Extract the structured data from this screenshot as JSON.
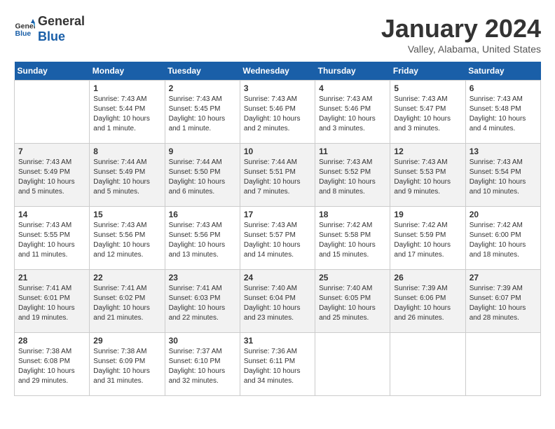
{
  "header": {
    "logo_line1": "General",
    "logo_line2": "Blue",
    "month": "January 2024",
    "location": "Valley, Alabama, United States"
  },
  "weekdays": [
    "Sunday",
    "Monday",
    "Tuesday",
    "Wednesday",
    "Thursday",
    "Friday",
    "Saturday"
  ],
  "weeks": [
    [
      {
        "day": "",
        "info": ""
      },
      {
        "day": "1",
        "info": "Sunrise: 7:43 AM\nSunset: 5:44 PM\nDaylight: 10 hours\nand 1 minute."
      },
      {
        "day": "2",
        "info": "Sunrise: 7:43 AM\nSunset: 5:45 PM\nDaylight: 10 hours\nand 1 minute."
      },
      {
        "day": "3",
        "info": "Sunrise: 7:43 AM\nSunset: 5:46 PM\nDaylight: 10 hours\nand 2 minutes."
      },
      {
        "day": "4",
        "info": "Sunrise: 7:43 AM\nSunset: 5:46 PM\nDaylight: 10 hours\nand 3 minutes."
      },
      {
        "day": "5",
        "info": "Sunrise: 7:43 AM\nSunset: 5:47 PM\nDaylight: 10 hours\nand 3 minutes."
      },
      {
        "day": "6",
        "info": "Sunrise: 7:43 AM\nSunset: 5:48 PM\nDaylight: 10 hours\nand 4 minutes."
      }
    ],
    [
      {
        "day": "7",
        "info": "Sunrise: 7:43 AM\nSunset: 5:49 PM\nDaylight: 10 hours\nand 5 minutes."
      },
      {
        "day": "8",
        "info": "Sunrise: 7:44 AM\nSunset: 5:49 PM\nDaylight: 10 hours\nand 5 minutes."
      },
      {
        "day": "9",
        "info": "Sunrise: 7:44 AM\nSunset: 5:50 PM\nDaylight: 10 hours\nand 6 minutes."
      },
      {
        "day": "10",
        "info": "Sunrise: 7:44 AM\nSunset: 5:51 PM\nDaylight: 10 hours\nand 7 minutes."
      },
      {
        "day": "11",
        "info": "Sunrise: 7:43 AM\nSunset: 5:52 PM\nDaylight: 10 hours\nand 8 minutes."
      },
      {
        "day": "12",
        "info": "Sunrise: 7:43 AM\nSunset: 5:53 PM\nDaylight: 10 hours\nand 9 minutes."
      },
      {
        "day": "13",
        "info": "Sunrise: 7:43 AM\nSunset: 5:54 PM\nDaylight: 10 hours\nand 10 minutes."
      }
    ],
    [
      {
        "day": "14",
        "info": "Sunrise: 7:43 AM\nSunset: 5:55 PM\nDaylight: 10 hours\nand 11 minutes."
      },
      {
        "day": "15",
        "info": "Sunrise: 7:43 AM\nSunset: 5:56 PM\nDaylight: 10 hours\nand 12 minutes."
      },
      {
        "day": "16",
        "info": "Sunrise: 7:43 AM\nSunset: 5:56 PM\nDaylight: 10 hours\nand 13 minutes."
      },
      {
        "day": "17",
        "info": "Sunrise: 7:43 AM\nSunset: 5:57 PM\nDaylight: 10 hours\nand 14 minutes."
      },
      {
        "day": "18",
        "info": "Sunrise: 7:42 AM\nSunset: 5:58 PM\nDaylight: 10 hours\nand 15 minutes."
      },
      {
        "day": "19",
        "info": "Sunrise: 7:42 AM\nSunset: 5:59 PM\nDaylight: 10 hours\nand 17 minutes."
      },
      {
        "day": "20",
        "info": "Sunrise: 7:42 AM\nSunset: 6:00 PM\nDaylight: 10 hours\nand 18 minutes."
      }
    ],
    [
      {
        "day": "21",
        "info": "Sunrise: 7:41 AM\nSunset: 6:01 PM\nDaylight: 10 hours\nand 19 minutes."
      },
      {
        "day": "22",
        "info": "Sunrise: 7:41 AM\nSunset: 6:02 PM\nDaylight: 10 hours\nand 21 minutes."
      },
      {
        "day": "23",
        "info": "Sunrise: 7:41 AM\nSunset: 6:03 PM\nDaylight: 10 hours\nand 22 minutes."
      },
      {
        "day": "24",
        "info": "Sunrise: 7:40 AM\nSunset: 6:04 PM\nDaylight: 10 hours\nand 23 minutes."
      },
      {
        "day": "25",
        "info": "Sunrise: 7:40 AM\nSunset: 6:05 PM\nDaylight: 10 hours\nand 25 minutes."
      },
      {
        "day": "26",
        "info": "Sunrise: 7:39 AM\nSunset: 6:06 PM\nDaylight: 10 hours\nand 26 minutes."
      },
      {
        "day": "27",
        "info": "Sunrise: 7:39 AM\nSunset: 6:07 PM\nDaylight: 10 hours\nand 28 minutes."
      }
    ],
    [
      {
        "day": "28",
        "info": "Sunrise: 7:38 AM\nSunset: 6:08 PM\nDaylight: 10 hours\nand 29 minutes."
      },
      {
        "day": "29",
        "info": "Sunrise: 7:38 AM\nSunset: 6:09 PM\nDaylight: 10 hours\nand 31 minutes."
      },
      {
        "day": "30",
        "info": "Sunrise: 7:37 AM\nSunset: 6:10 PM\nDaylight: 10 hours\nand 32 minutes."
      },
      {
        "day": "31",
        "info": "Sunrise: 7:36 AM\nSunset: 6:11 PM\nDaylight: 10 hours\nand 34 minutes."
      },
      {
        "day": "",
        "info": ""
      },
      {
        "day": "",
        "info": ""
      },
      {
        "day": "",
        "info": ""
      }
    ]
  ]
}
